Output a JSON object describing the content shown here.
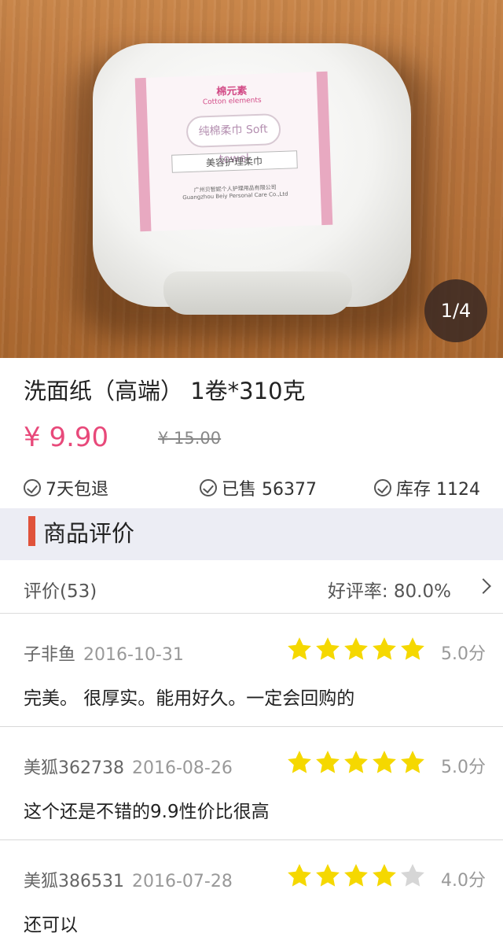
{
  "gallery": {
    "page_indicator": "1/4",
    "package": {
      "brand_cn": "棉元素",
      "brand_en": "Cotton elements",
      "product_cn": "纯棉柔巾",
      "product_en": "Soft towel",
      "subtitle": "美容护理柔巾",
      "maker_cn": "广州贝智妮个人护理用品有限公司",
      "maker_en": "Guangzhou Beiy Personal Care Co.,Ltd"
    }
  },
  "product": {
    "title": "洗面纸（高端） 1卷*310克",
    "price": "¥ 9.90",
    "original_price": "¥ 15.00"
  },
  "features": [
    {
      "label": "7天包退",
      "icon": "check-circle-icon"
    },
    {
      "label": "已售 56377",
      "icon": "check-circle-icon"
    },
    {
      "label": "库存 1124",
      "icon": "check-circle-icon"
    }
  ],
  "reviews_section": {
    "title": "商品评价",
    "count_label": "评价(53)",
    "positive_rate": "好评率: 80.0%"
  },
  "reviews": [
    {
      "user": "子非鱼",
      "date": "2016-10-31",
      "rating": 5,
      "score": "5.0分",
      "text": "完美。 很厚实。能用好久。一定会回购的"
    },
    {
      "user": "美狐362738",
      "date": "2016-08-26",
      "rating": 5,
      "score": "5.0分",
      "text": "这个还是不错的9.9性价比很高"
    },
    {
      "user": "美狐386531",
      "date": "2016-07-28",
      "rating": 4,
      "score": "4.0分",
      "text": "还可以"
    }
  ],
  "colors": {
    "price": "#e8497a",
    "section_accent": "#e0523a",
    "star_filled": "#f5d800",
    "star_empty": "#d6d6d6",
    "section_bg": "#ecedf4"
  }
}
